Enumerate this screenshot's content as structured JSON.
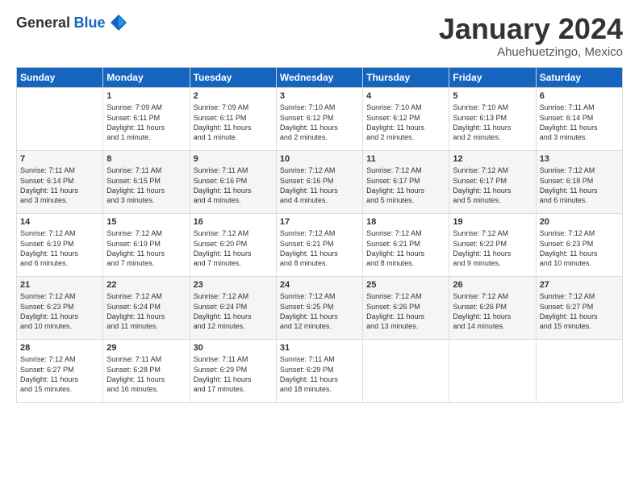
{
  "logo": {
    "general": "General",
    "blue": "Blue"
  },
  "title": "January 2024",
  "location": "Ahuehuetzingo, Mexico",
  "headers": [
    "Sunday",
    "Monday",
    "Tuesday",
    "Wednesday",
    "Thursday",
    "Friday",
    "Saturday"
  ],
  "weeks": [
    [
      {
        "day": "",
        "info": ""
      },
      {
        "day": "1",
        "info": "Sunrise: 7:09 AM\nSunset: 6:11 PM\nDaylight: 11 hours\nand 1 minute."
      },
      {
        "day": "2",
        "info": "Sunrise: 7:09 AM\nSunset: 6:11 PM\nDaylight: 11 hours\nand 1 minute."
      },
      {
        "day": "3",
        "info": "Sunrise: 7:10 AM\nSunset: 6:12 PM\nDaylight: 11 hours\nand 2 minutes."
      },
      {
        "day": "4",
        "info": "Sunrise: 7:10 AM\nSunset: 6:12 PM\nDaylight: 11 hours\nand 2 minutes."
      },
      {
        "day": "5",
        "info": "Sunrise: 7:10 AM\nSunset: 6:13 PM\nDaylight: 11 hours\nand 2 minutes."
      },
      {
        "day": "6",
        "info": "Sunrise: 7:11 AM\nSunset: 6:14 PM\nDaylight: 11 hours\nand 3 minutes."
      }
    ],
    [
      {
        "day": "7",
        "info": "Sunrise: 7:11 AM\nSunset: 6:14 PM\nDaylight: 11 hours\nand 3 minutes."
      },
      {
        "day": "8",
        "info": "Sunrise: 7:11 AM\nSunset: 6:15 PM\nDaylight: 11 hours\nand 3 minutes."
      },
      {
        "day": "9",
        "info": "Sunrise: 7:11 AM\nSunset: 6:16 PM\nDaylight: 11 hours\nand 4 minutes."
      },
      {
        "day": "10",
        "info": "Sunrise: 7:12 AM\nSunset: 6:16 PM\nDaylight: 11 hours\nand 4 minutes."
      },
      {
        "day": "11",
        "info": "Sunrise: 7:12 AM\nSunset: 6:17 PM\nDaylight: 11 hours\nand 5 minutes."
      },
      {
        "day": "12",
        "info": "Sunrise: 7:12 AM\nSunset: 6:17 PM\nDaylight: 11 hours\nand 5 minutes."
      },
      {
        "day": "13",
        "info": "Sunrise: 7:12 AM\nSunset: 6:18 PM\nDaylight: 11 hours\nand 6 minutes."
      }
    ],
    [
      {
        "day": "14",
        "info": "Sunrise: 7:12 AM\nSunset: 6:19 PM\nDaylight: 11 hours\nand 6 minutes."
      },
      {
        "day": "15",
        "info": "Sunrise: 7:12 AM\nSunset: 6:19 PM\nDaylight: 11 hours\nand 7 minutes."
      },
      {
        "day": "16",
        "info": "Sunrise: 7:12 AM\nSunset: 6:20 PM\nDaylight: 11 hours\nand 7 minutes."
      },
      {
        "day": "17",
        "info": "Sunrise: 7:12 AM\nSunset: 6:21 PM\nDaylight: 11 hours\nand 8 minutes."
      },
      {
        "day": "18",
        "info": "Sunrise: 7:12 AM\nSunset: 6:21 PM\nDaylight: 11 hours\nand 8 minutes."
      },
      {
        "day": "19",
        "info": "Sunrise: 7:12 AM\nSunset: 6:22 PM\nDaylight: 11 hours\nand 9 minutes."
      },
      {
        "day": "20",
        "info": "Sunrise: 7:12 AM\nSunset: 6:23 PM\nDaylight: 11 hours\nand 10 minutes."
      }
    ],
    [
      {
        "day": "21",
        "info": "Sunrise: 7:12 AM\nSunset: 6:23 PM\nDaylight: 11 hours\nand 10 minutes."
      },
      {
        "day": "22",
        "info": "Sunrise: 7:12 AM\nSunset: 6:24 PM\nDaylight: 11 hours\nand 11 minutes."
      },
      {
        "day": "23",
        "info": "Sunrise: 7:12 AM\nSunset: 6:24 PM\nDaylight: 11 hours\nand 12 minutes."
      },
      {
        "day": "24",
        "info": "Sunrise: 7:12 AM\nSunset: 6:25 PM\nDaylight: 11 hours\nand 12 minutes."
      },
      {
        "day": "25",
        "info": "Sunrise: 7:12 AM\nSunset: 6:26 PM\nDaylight: 11 hours\nand 13 minutes."
      },
      {
        "day": "26",
        "info": "Sunrise: 7:12 AM\nSunset: 6:26 PM\nDaylight: 11 hours\nand 14 minutes."
      },
      {
        "day": "27",
        "info": "Sunrise: 7:12 AM\nSunset: 6:27 PM\nDaylight: 11 hours\nand 15 minutes."
      }
    ],
    [
      {
        "day": "28",
        "info": "Sunrise: 7:12 AM\nSunset: 6:27 PM\nDaylight: 11 hours\nand 15 minutes."
      },
      {
        "day": "29",
        "info": "Sunrise: 7:11 AM\nSunset: 6:28 PM\nDaylight: 11 hours\nand 16 minutes."
      },
      {
        "day": "30",
        "info": "Sunrise: 7:11 AM\nSunset: 6:29 PM\nDaylight: 11 hours\nand 17 minutes."
      },
      {
        "day": "31",
        "info": "Sunrise: 7:11 AM\nSunset: 6:29 PM\nDaylight: 11 hours\nand 18 minutes."
      },
      {
        "day": "",
        "info": ""
      },
      {
        "day": "",
        "info": ""
      },
      {
        "day": "",
        "info": ""
      }
    ]
  ]
}
